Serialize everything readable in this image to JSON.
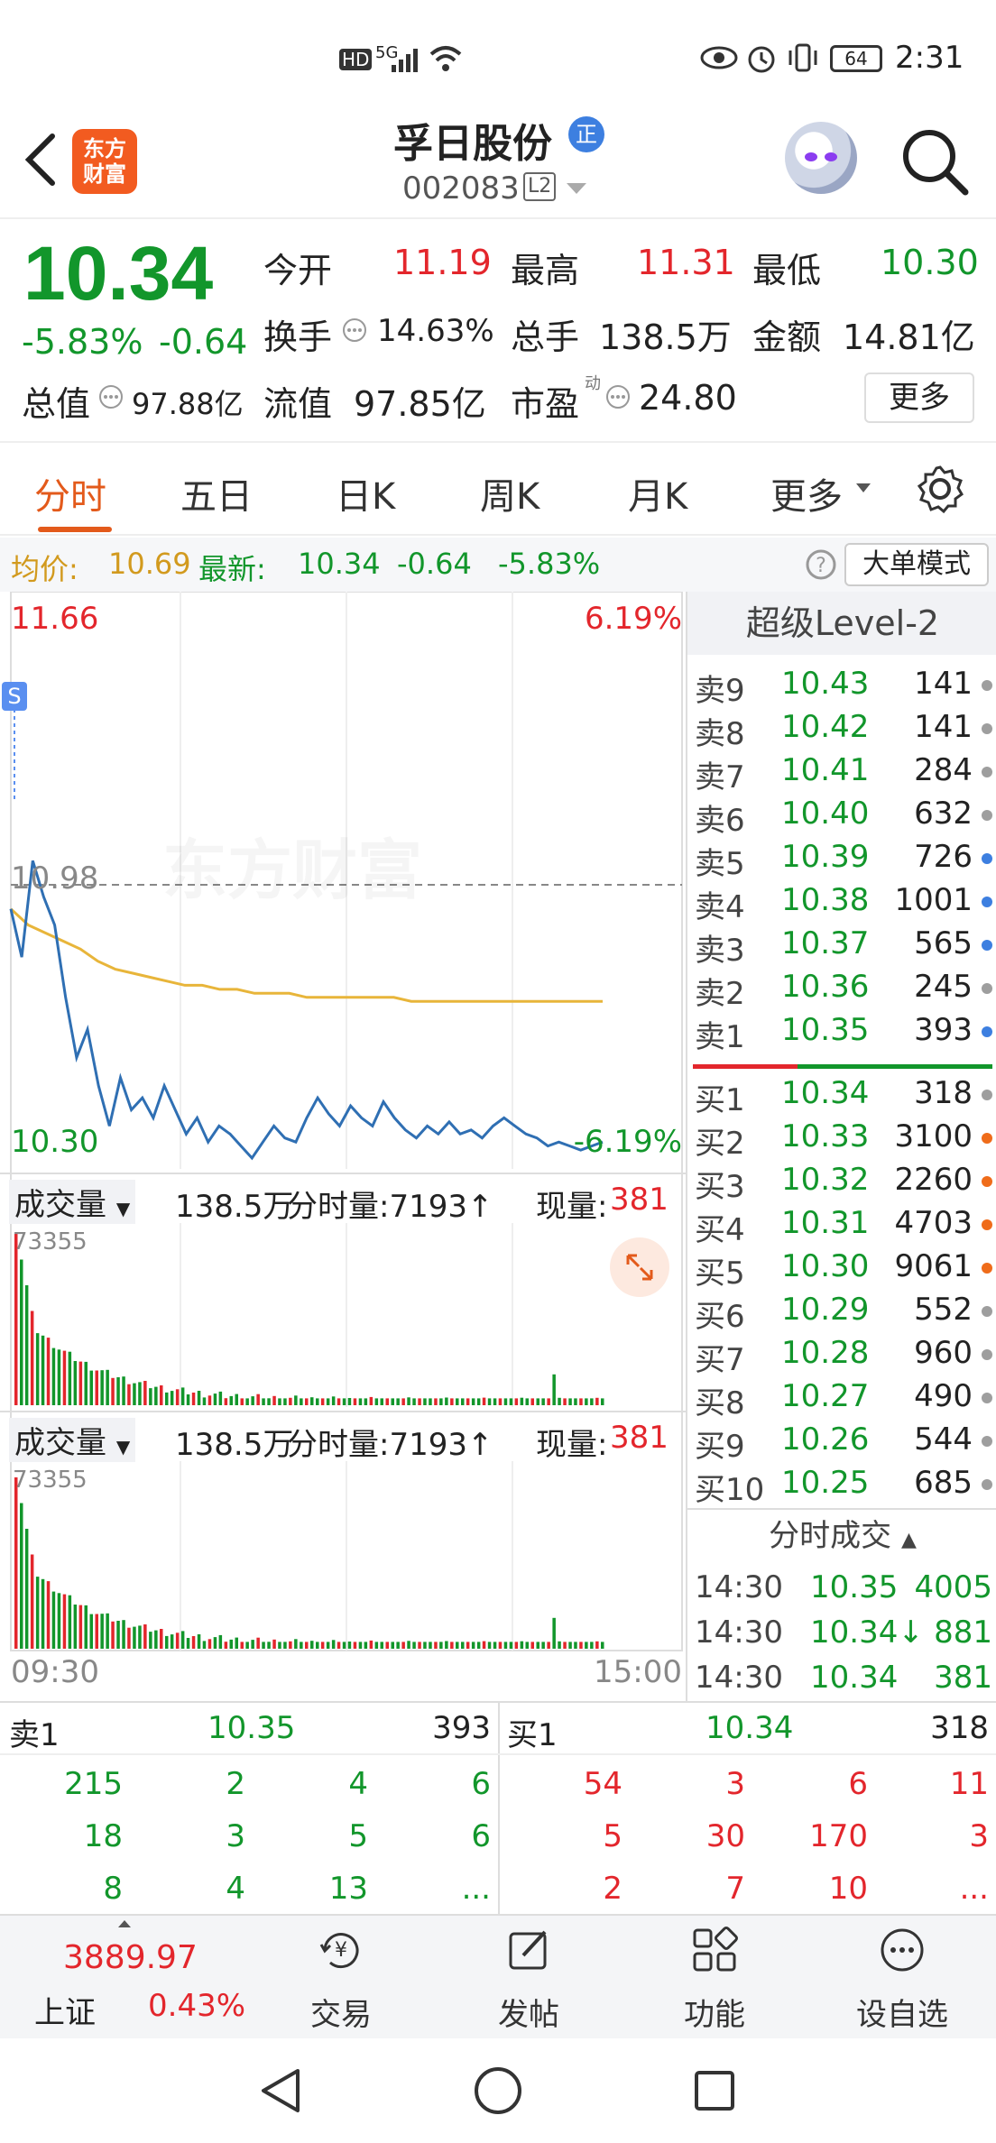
{
  "status_bar": {
    "time": "2:31",
    "battery": "64",
    "hd": "HD",
    "net": "5G"
  },
  "header": {
    "logo_line1": "东方",
    "logo_line2": "财富",
    "title": "孚日股份",
    "badge": "正",
    "code": "002083",
    "level": "L2"
  },
  "quote": {
    "price": "10.34",
    "change_pct": "-5.83%",
    "change": "-0.64",
    "open_label": "今开",
    "open": "11.19",
    "high_label": "最高",
    "high": "11.31",
    "low_label": "最低",
    "low": "10.30",
    "turnover_label": "换手",
    "turnover": "14.63%",
    "volume_label": "总手",
    "volume": "138.5万",
    "amount_label": "金额",
    "amount": "14.81亿",
    "mktcap_label": "总值",
    "mktcap": "97.88亿",
    "float_label": "流值",
    "float": "97.85亿",
    "pe_label": "市盈",
    "pe_sup": "动",
    "pe": "24.80",
    "more": "更多"
  },
  "tabs": [
    "分时",
    "五日",
    "日K",
    "周K",
    "月K",
    "更多"
  ],
  "avg_row": {
    "avg_label": "均价:",
    "avg": "10.69",
    "latest_label": "最新:",
    "latest": "10.34",
    "change": "-0.64",
    "pct": "-5.83%",
    "mode": "大单模式"
  },
  "chart_data": {
    "type": "line",
    "y_top": "11.66",
    "y_top_pct": "6.19%",
    "y_mid": "10.98",
    "y_bottom": "10.30",
    "y_bottom_pct": "-6.19%",
    "x_start": "09:30",
    "x_end": "15:00",
    "watermark": "东方财富",
    "ylim": [
      10.3,
      11.66
    ],
    "series": [
      {
        "values": [
          10.92,
          10.8,
          11.04,
          10.95,
          10.88,
          10.7,
          10.55,
          10.62,
          10.48,
          10.38,
          10.5,
          10.42,
          10.45,
          10.4,
          10.48,
          10.42,
          10.36,
          10.4,
          10.34,
          10.38,
          10.36,
          10.33,
          10.3,
          10.34,
          10.38,
          10.35,
          10.34,
          10.4,
          10.45,
          10.41,
          10.38,
          10.43,
          10.4,
          10.38,
          10.44,
          10.4,
          10.37,
          10.35,
          10.38,
          10.36,
          10.39,
          10.36,
          10.37,
          10.35,
          10.38,
          10.4,
          10.38,
          10.36,
          10.35,
          10.33,
          10.34,
          10.33,
          10.32,
          10.33,
          10.34
        ]
      },
      {
        "values": [
          10.92,
          10.88,
          10.86,
          10.84,
          10.82,
          10.79,
          10.77,
          10.76,
          10.75,
          10.74,
          10.73,
          10.73,
          10.72,
          10.72,
          10.71,
          10.71,
          10.71,
          10.7,
          10.7,
          10.7,
          10.7,
          10.7,
          10.7,
          10.69,
          10.69,
          10.69,
          10.69,
          10.69,
          10.69,
          10.69,
          10.69,
          10.69,
          10.69,
          10.69,
          10.69
        ]
      }
    ],
    "volume": {
      "label": "成交量",
      "total": "138.5万",
      "tick_label": "分时量:7193↑",
      "now_label": "现量:",
      "now": "381",
      "max": "73355"
    }
  },
  "book": {
    "header": "超级Level-2",
    "asks": [
      {
        "label": "卖9",
        "price": "10.43",
        "vol": "141",
        "dot": "#9e9e9e"
      },
      {
        "label": "卖8",
        "price": "10.42",
        "vol": "141",
        "dot": "#9e9e9e"
      },
      {
        "label": "卖7",
        "price": "10.41",
        "vol": "284",
        "dot": "#9e9e9e"
      },
      {
        "label": "卖6",
        "price": "10.40",
        "vol": "632",
        "dot": "#9e9e9e"
      },
      {
        "label": "卖5",
        "price": "10.39",
        "vol": "726",
        "dot": "#3d7fe0"
      },
      {
        "label": "卖4",
        "price": "10.38",
        "vol": "1001",
        "dot": "#3d7fe0"
      },
      {
        "label": "卖3",
        "price": "10.37",
        "vol": "565",
        "dot": "#3d7fe0"
      },
      {
        "label": "卖2",
        "price": "10.36",
        "vol": "245",
        "dot": "#9e9e9e"
      },
      {
        "label": "卖1",
        "price": "10.35",
        "vol": "393",
        "dot": "#3d7fe0"
      }
    ],
    "bids": [
      {
        "label": "买1",
        "price": "10.34",
        "vol": "318",
        "dot": "#9e9e9e"
      },
      {
        "label": "买2",
        "price": "10.33",
        "vol": "3100",
        "dot": "#ef6c1a"
      },
      {
        "label": "买3",
        "price": "10.32",
        "vol": "2260",
        "dot": "#ef6c1a"
      },
      {
        "label": "买4",
        "price": "10.31",
        "vol": "4703",
        "dot": "#ef6c1a"
      },
      {
        "label": "买5",
        "price": "10.30",
        "vol": "9061",
        "dot": "#ef6c1a"
      },
      {
        "label": "买6",
        "price": "10.29",
        "vol": "552",
        "dot": "#9e9e9e"
      },
      {
        "label": "买7",
        "price": "10.28",
        "vol": "960",
        "dot": "#9e9e9e"
      },
      {
        "label": "买8",
        "price": "10.27",
        "vol": "490",
        "dot": "#9e9e9e"
      },
      {
        "label": "买9",
        "price": "10.26",
        "vol": "544",
        "dot": "#9e9e9e"
      },
      {
        "label": "买10",
        "price": "10.25",
        "vol": "685",
        "dot": "#9e9e9e"
      }
    ],
    "ticks_header": "分时成交",
    "ticks": [
      {
        "time": "14:30",
        "price": "10.35",
        "vol": "4005"
      },
      {
        "time": "14:30",
        "price": "10.34↓",
        "vol": "881"
      },
      {
        "time": "14:30",
        "price": "10.34",
        "vol": "381"
      }
    ]
  },
  "l2": {
    "sell_label": "卖1",
    "sell_price": "10.35",
    "sell_vol": "393",
    "buy_label": "买1",
    "buy_price": "10.34",
    "buy_vol": "318",
    "sell_rows": [
      [
        "215",
        "2",
        "4",
        "6"
      ],
      [
        "18",
        "3",
        "5",
        "6"
      ],
      [
        "8",
        "4",
        "13",
        "..."
      ]
    ],
    "buy_rows": [
      [
        "54",
        "3",
        "6",
        "11"
      ],
      [
        "5",
        "30",
        "170",
        "3"
      ],
      [
        "2",
        "7",
        "10",
        "..."
      ]
    ]
  },
  "bottom_nav": {
    "index_value": "3889.97",
    "index_name": "上证",
    "index_pct": "0.43%",
    "items": [
      "交易",
      "发帖",
      "功能",
      "设自选"
    ]
  },
  "colors": {
    "up": "#e3262c",
    "down": "#12962b",
    "accent": "#e35a1b",
    "price_line": "#2f6fb3",
    "avg_line": "#e8b53a"
  }
}
